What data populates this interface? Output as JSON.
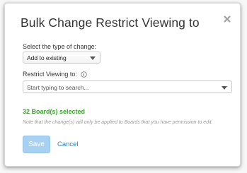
{
  "dialog": {
    "title": "Bulk Change Restrict Viewing to"
  },
  "change_type": {
    "label": "Select the type of change:",
    "selected_value": "Add to existing"
  },
  "restrict_viewing": {
    "label": "Restrict Viewing to:",
    "placeholder": "Start typing to search..."
  },
  "selection": {
    "summary": "32 Board(s) selected",
    "note": "Note that the change(s) will only be applied to Boards that you have permission to edit."
  },
  "actions": {
    "save_label": "Save",
    "cancel_label": "Cancel"
  },
  "colors": {
    "selected_text": "#3aa12b",
    "save_button_bg": "#a8d1f1",
    "cancel_link": "#2a7fc0"
  },
  "icons": {
    "close": "close-icon",
    "info": "info-icon",
    "dropdown": "chevron-down-icon"
  }
}
